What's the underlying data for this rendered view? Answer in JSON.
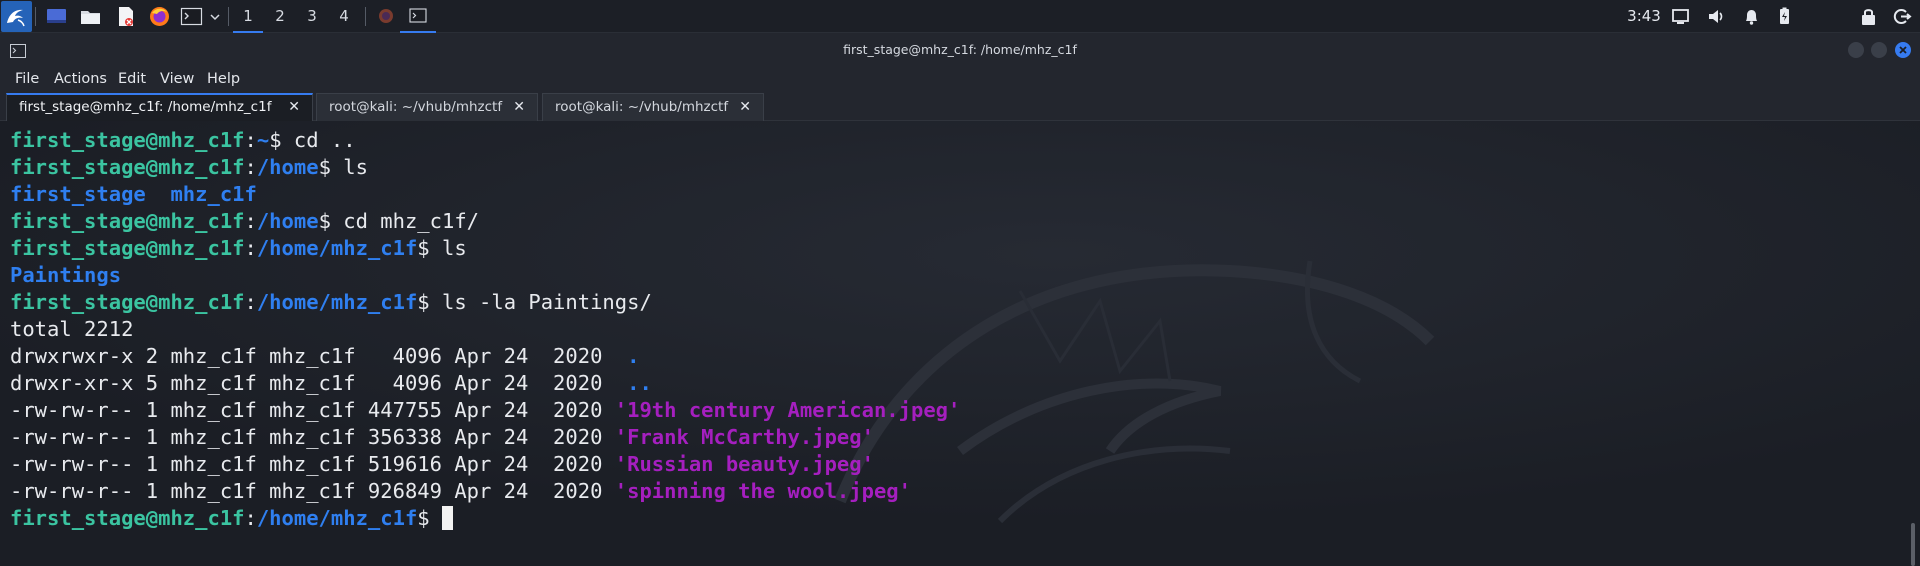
{
  "panel": {
    "launchers": [
      "kali-menu-icon",
      "desktop-icon",
      "file-manager-icon",
      "text-editor-icon",
      "firefox-icon",
      "terminal-icon"
    ],
    "workspaces": [
      "1",
      "2",
      "3",
      "4"
    ],
    "clock": "3:43",
    "tray": [
      "screen-icon",
      "volume-icon",
      "notification-bell-icon",
      "battery-icon",
      "lock-icon",
      "power-icon"
    ]
  },
  "window": {
    "title": "first_stage@mhz_c1f: /home/mhz_c1f"
  },
  "menubar": {
    "items": [
      "File",
      "Actions",
      "Edit",
      "View",
      "Help"
    ]
  },
  "tabs": [
    {
      "label": "first_stage@mhz_c1f: /home/mhz_c1f",
      "active": true
    },
    {
      "label": "root@kali: ~/vhub/mhzctf",
      "active": false
    },
    {
      "label": "root@kali: ~/vhub/mhzctf",
      "active": false
    }
  ],
  "terminal": {
    "user": "first_stage@mhz_c1f",
    "lines": [
      {
        "type": "prompt",
        "path": "~",
        "cmd": " cd .."
      },
      {
        "type": "prompt",
        "path": "/home",
        "cmd": " ls"
      },
      {
        "type": "out",
        "text": "first_stage  mhz_c1f",
        "style": "d"
      },
      {
        "type": "prompt",
        "path": "/home",
        "cmd": " cd mhz_c1f/"
      },
      {
        "type": "prompt",
        "path": "/home/mhz_c1f",
        "cmd": " ls"
      },
      {
        "type": "out",
        "text": "Paintings",
        "style": "d"
      },
      {
        "type": "prompt",
        "path": "/home/mhz_c1f",
        "cmd": " ls -la Paintings/"
      },
      {
        "type": "out",
        "text": "total 2212",
        "style": ""
      },
      {
        "type": "ls",
        "meta": "drwxrwxr-x 2 mhz_c1f mhz_c1f   4096 Apr 24  2020 ",
        "name": " .",
        "style": "d"
      },
      {
        "type": "ls",
        "meta": "drwxr-xr-x 5 mhz_c1f mhz_c1f   4096 Apr 24  2020 ",
        "name": " ..",
        "style": "d"
      },
      {
        "type": "ls",
        "meta": "-rw-rw-r-- 1 mhz_c1f mhz_c1f 447755 Apr 24  2020 ",
        "name": "'19th century American.jpeg'",
        "style": "f"
      },
      {
        "type": "ls",
        "meta": "-rw-rw-r-- 1 mhz_c1f mhz_c1f 356338 Apr 24  2020 ",
        "name": "'Frank McCarthy.jpeg'",
        "style": "f"
      },
      {
        "type": "ls",
        "meta": "-rw-rw-r-- 1 mhz_c1f mhz_c1f 519616 Apr 24  2020 ",
        "name": "'Russian beauty.jpeg'",
        "style": "f"
      },
      {
        "type": "ls",
        "meta": "-rw-rw-r-- 1 mhz_c1f mhz_c1f 926849 Apr 24  2020 ",
        "name": "'spinning the wool.jpeg'",
        "style": "f"
      },
      {
        "type": "prompt",
        "path": "/home/mhz_c1f",
        "cmd": " ",
        "cursor": true
      }
    ]
  },
  "colors": {
    "accent": "#367bf0",
    "prompt_user": "#3bc4a1",
    "prompt_path": "#2f7ff0",
    "file_name": "#a51fbf"
  }
}
